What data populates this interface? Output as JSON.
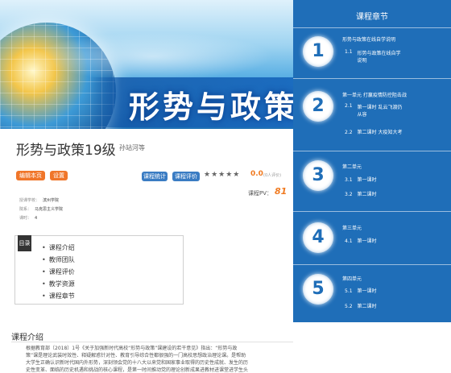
{
  "banner": {
    "title": "形势与政策"
  },
  "course": {
    "title": "形势与政策19级",
    "subtitle": "孙站河等",
    "buttons": {
      "edit_mode": "编辑本页",
      "settings": "设置",
      "course_stats": "课程统计",
      "course_review": "课程评价"
    },
    "rating_stars": "★★★★★",
    "score": "0.0",
    "score_note": "(0人评价)",
    "pv_label": "课程PV：",
    "pv_value": "81"
  },
  "info": {
    "school_label": "授课学校：",
    "school_value": "滨州学院",
    "dept_label": "院系：",
    "dept_value": "马克思主义学院",
    "hours_label": "课时：",
    "hours_value": "4"
  },
  "directory": {
    "tag": "目录",
    "items": [
      "课程介绍",
      "教师团队",
      "课程评价",
      "教学资源",
      "课程章节"
    ]
  },
  "intro": {
    "heading": "课程介绍",
    "lines": [
      "根据教育部〔2018〕1号《关于加强新时代高校“形势与政策”课建设的若干意见》指出：“形势与政",
      "策”课是理论武装时效性、释疑解惑针对性、教育引导综合性都很强的一门高校思想政治理论课。是帮助",
      "大学生正确认识新时代国内外形势，深刻领会党的十八大以来党和国家事业取得的历史性成就、发生的历",
      "史性变革、面临的历史机遇和挑战的核心课程，是第一时间推动党的理论创新成果进教材进课堂进学生头"
    ]
  },
  "sidebar": {
    "title": "课程章节",
    "sections": [
      {
        "num": "1",
        "unit": "形势与政策在线自学说明",
        "lessons": [
          {
            "num": "1.1",
            "lines": [
              "形势与政策在线自学",
              "说明"
            ]
          }
        ]
      },
      {
        "num": "2",
        "unit": "第一单元 打赢疫情防控阻击战",
        "lessons": [
          {
            "num": "2.1",
            "lines": [
              "第一课时 乱云飞渡仍",
              "从容"
            ]
          },
          {
            "num": "2.2",
            "lines": [
              "第二课时 大疫知大考"
            ]
          }
        ]
      },
      {
        "num": "3",
        "unit": "第二单元",
        "lessons": [
          {
            "num": "3.1",
            "lines": [
              "第一课时"
            ]
          },
          {
            "num": "3.2",
            "lines": [
              "第二课时"
            ]
          }
        ]
      },
      {
        "num": "4",
        "unit": "第三单元",
        "lessons": [
          {
            "num": "4.1",
            "lines": [
              "第一课时"
            ]
          }
        ]
      },
      {
        "num": "5",
        "unit": "第四单元",
        "lessons": [
          {
            "num": "5.1",
            "lines": [
              "第一课时"
            ]
          },
          {
            "num": "5.2",
            "lines": [
              "第二课时"
            ]
          }
        ]
      }
    ]
  }
}
